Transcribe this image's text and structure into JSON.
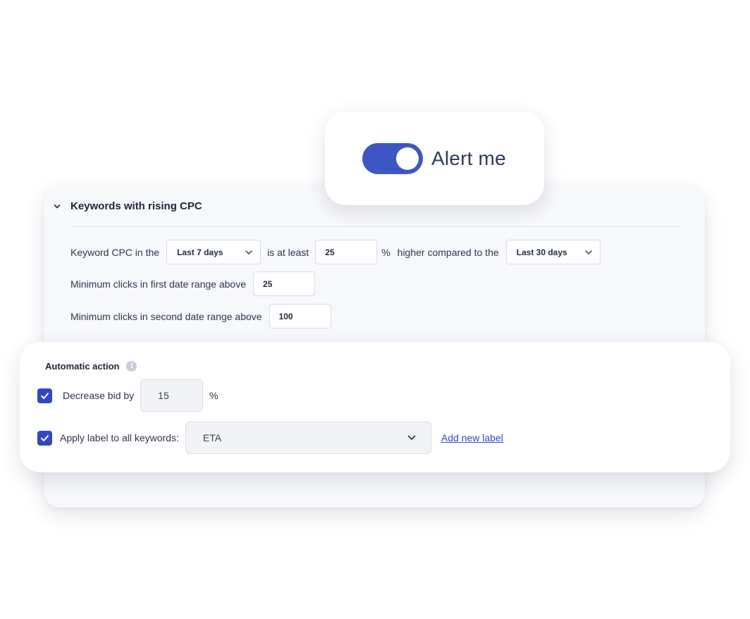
{
  "alert": {
    "label": "Alert me",
    "enabled": true,
    "toggle_color": "#3d56c4"
  },
  "rule": {
    "title": "Keywords with rising CPC",
    "row1": {
      "prefix": "Keyword CPC in the",
      "period1": "Last 7 days",
      "middle": "is at least",
      "percent_value": "25",
      "percent_sign": "%",
      "suffix": "higher compared to the",
      "period2": "Last 30 days"
    },
    "row2": {
      "label": "Minimum clicks in first date range above",
      "value": "25"
    },
    "row3": {
      "label": "Minimum clicks in second date range above",
      "value": "100"
    }
  },
  "action": {
    "title": "Automatic action",
    "info_icon": "info-icon",
    "decrease": {
      "checked": true,
      "label": "Decrease bid by",
      "value": "15",
      "unit": "%"
    },
    "apply_label": {
      "checked": true,
      "label": "Apply label to all keywords:",
      "selected": "ETA",
      "link": "Add new label"
    },
    "accent_color": "#3147c2"
  }
}
